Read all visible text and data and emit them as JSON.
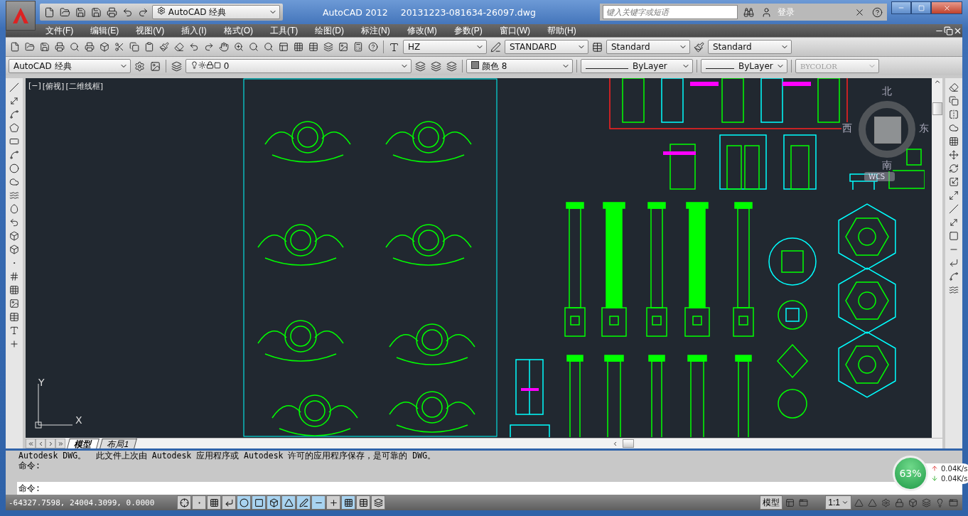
{
  "title_bar": {
    "workspace": "AutoCAD 经典",
    "app_title": "AutoCAD 2012",
    "file_name": "20131223-081634-26097.dwg",
    "search": {
      "placeholder": "键入关键字或短语"
    },
    "login": "登录"
  },
  "menu": [
    "文件(F)",
    "编辑(E)",
    "视图(V)",
    "插入(I)",
    "格式(O)",
    "工具(T)",
    "绘图(D)",
    "标注(N)",
    "修改(M)",
    "参数(P)",
    "窗口(W)",
    "帮助(H)"
  ],
  "styles_toolbar": {
    "text_style": "HZ",
    "dim_style": "STANDARD",
    "table_style": "Standard",
    "multileader_style": "Standard"
  },
  "layers_toolbar": {
    "workspace": "AutoCAD 经典",
    "layer": "0",
    "color_label": "颜色 8",
    "linetype": "ByLayer",
    "lineweight": "ByLayer",
    "plot_style": {
      "text": "BYCOLOR",
      "disabled": true
    }
  },
  "viewport": {
    "labels": [
      "[−]",
      "[俯视]",
      "[二维线框]"
    ],
    "viewcube": {
      "north": "北",
      "south": "南",
      "east": "东",
      "west": "西",
      "ucs": "WCS"
    },
    "axes": {
      "y": "Y",
      "x": "X"
    }
  },
  "layout_tabs": [
    {
      "label": "模型",
      "selected": true
    },
    {
      "label": "布局1",
      "selected": false
    }
  ],
  "command_history": [
    "Autodesk DWG。  此文件上次由 Autodesk 应用程序或 Autodesk 许可的应用程序保存，是可靠的 DWG。",
    "命令:"
  ],
  "command_prompt": "命令:",
  "status_bar": {
    "coordinates": "-64327.7598, 24004.3099, 0.0000",
    "toggles": [
      {
        "kind": "infer",
        "on": false
      },
      {
        "kind": "snap",
        "on": false
      },
      {
        "kind": "grid",
        "on": false
      },
      {
        "kind": "ortho",
        "on": false
      },
      {
        "kind": "polar",
        "on": true
      },
      {
        "kind": "osnap",
        "on": true
      },
      {
        "kind": "osnap3d",
        "on": true
      },
      {
        "kind": "otrack",
        "on": true
      },
      {
        "kind": "ducs",
        "on": true
      },
      {
        "kind": "dyn",
        "on": true
      },
      {
        "kind": "lwt",
        "on": false
      },
      {
        "kind": "tpy",
        "on": true
      },
      {
        "kind": "qp",
        "on": false
      },
      {
        "kind": "sc",
        "on": false
      }
    ],
    "model": "模型",
    "scale": "1:1"
  },
  "network_meter": {
    "percent": "63%",
    "upload": "0.04K/s",
    "download": "0.04K/s"
  }
}
